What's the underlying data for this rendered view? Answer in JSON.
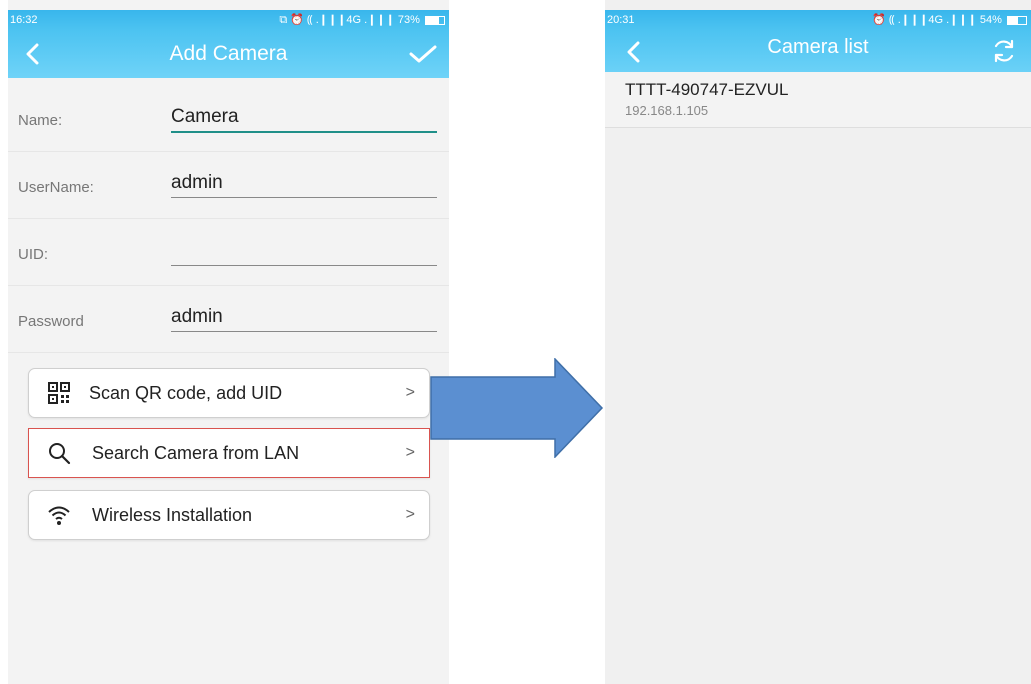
{
  "left_screen": {
    "status": {
      "time": "16:32",
      "icons": "⧉ ⏰ ⸨ .❙❙❙4G .❙❙❙",
      "battery": "73%",
      "battery_level": 0.73
    },
    "title": "Add Camera",
    "form": {
      "name": {
        "label": "Name:",
        "value": "Camera"
      },
      "username": {
        "label": "UserName:",
        "value": "admin"
      },
      "uid": {
        "label": "UID:",
        "value": ""
      },
      "password": {
        "label": "Password",
        "value": "admin"
      }
    },
    "buttons": [
      {
        "label": "Scan QR code, add UID",
        "icon": "qr-code-icon",
        "chevron": ">"
      },
      {
        "label": "Search Camera from LAN",
        "icon": "search-icon",
        "chevron": ">"
      },
      {
        "label": "Wireless Installation",
        "icon": "wifi-icon",
        "chevron": ">"
      }
    ]
  },
  "right_screen": {
    "status": {
      "time": "20:31",
      "icons": "⏰ ⸨ .❙❙❙4G .❙❙❙",
      "battery": "54%",
      "battery_level": 0.54
    },
    "title": "Camera list",
    "cameras": [
      {
        "name": "TTTT-490747-EZVUL",
        "ip": "192.168.1.105"
      }
    ]
  },
  "colors": {
    "header_blue": "#4cc3f1",
    "active_underline": "#1f8f88",
    "highlight_border": "#d9534f",
    "arrow_fill": "#5b8fd1",
    "arrow_stroke": "#3f6fa8"
  }
}
